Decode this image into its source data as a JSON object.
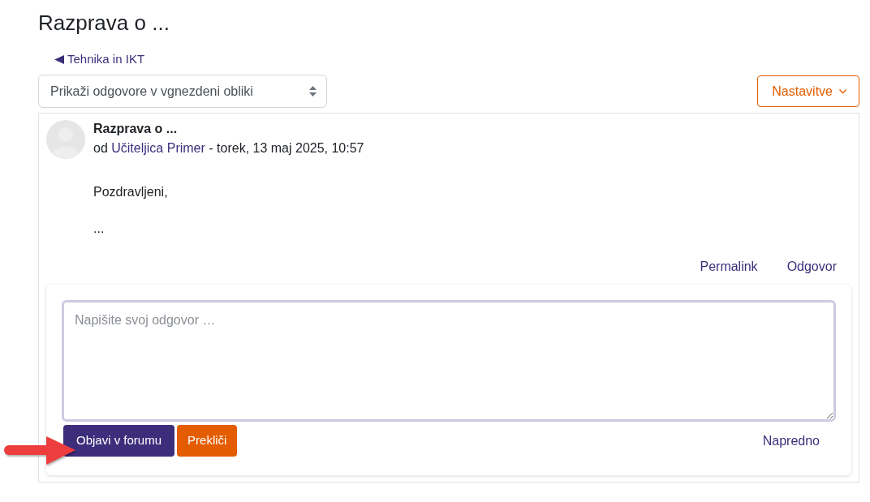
{
  "page": {
    "title": "Razprava o ..."
  },
  "back_link": {
    "label": "Tehnika in IKT"
  },
  "toolbar": {
    "display_mode": {
      "value": "Prikaži odgovore v vgnezdeni obliki"
    },
    "settings_button": {
      "label": "Nastavitve"
    }
  },
  "post": {
    "subject": "Razprava o ...",
    "byline": {
      "prefix": "od",
      "author": "Učiteljica Primer",
      "date": "- torek, 13 maj 2025, 10:57"
    },
    "message": [
      "Pozdravljeni,",
      "..."
    ],
    "actions": [
      "Permalink",
      "Odgovor"
    ]
  },
  "reply_form": {
    "placeholder": "Napišite svoj odgovor …",
    "buttons": [
      {
        "label": "Objavi v forumu",
        "kind": "primary"
      },
      {
        "label": "Prekliči",
        "kind": "cancel"
      }
    ],
    "advanced_link": "Napredno"
  }
}
